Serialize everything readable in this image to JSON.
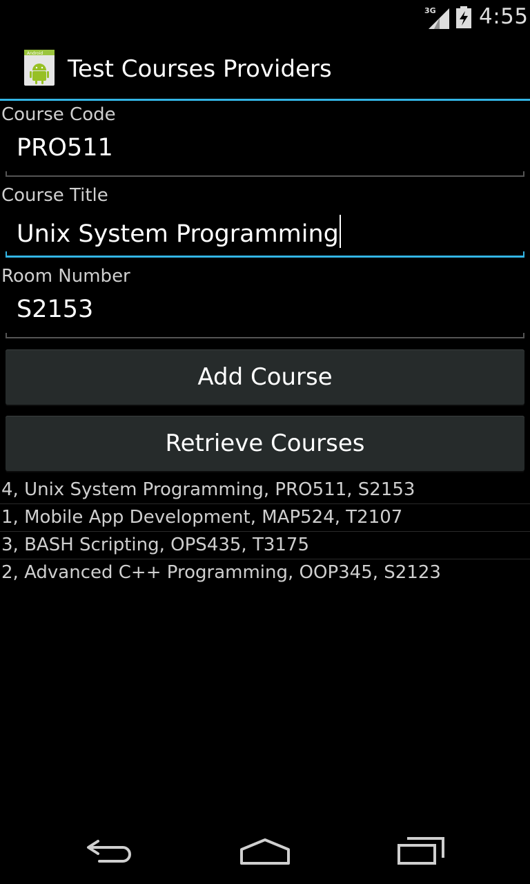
{
  "status_bar": {
    "network": "3G",
    "time": "4:55"
  },
  "action_bar": {
    "icon_label": "Android",
    "title": "Test Courses Providers"
  },
  "form": {
    "course_code": {
      "label": "Course Code",
      "value": "PRO511"
    },
    "course_title": {
      "label": "Course Title",
      "value": "Unix System Programming"
    },
    "room_number": {
      "label": "Room Number",
      "value": "S2153"
    }
  },
  "buttons": {
    "add": "Add Course",
    "retrieve": "Retrieve Courses"
  },
  "courses": [
    "4, Unix System Programming, PRO511, S2153",
    "1, Mobile App Development, MAP524, T2107",
    "3, BASH Scripting, OPS435, T3175",
    "2, Advanced C++ Programming, OOP345, S2123"
  ],
  "nav_bar": {
    "back_icon": "back-icon",
    "home_icon": "home-icon",
    "recents_icon": "recents-icon"
  },
  "colors": {
    "accent": "#33b5e5",
    "button_bg": "#262b2b",
    "background": "#000000"
  }
}
